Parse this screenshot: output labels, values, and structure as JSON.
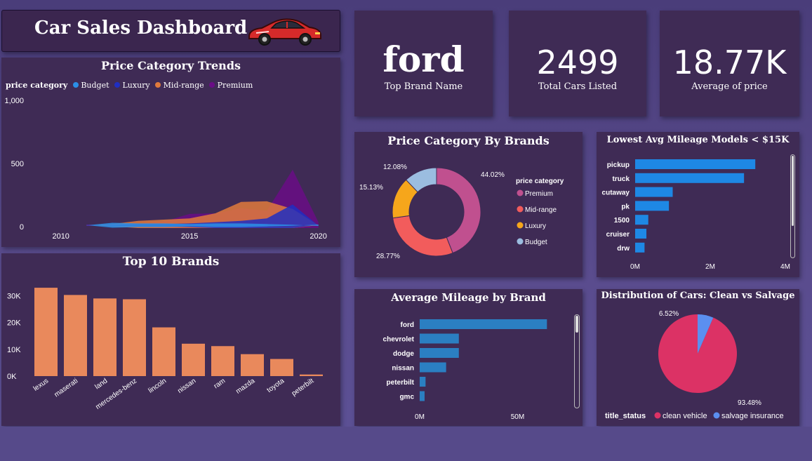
{
  "header": {
    "title": "Car Sales Dashboard",
    "car_icon": "red-sports-car"
  },
  "kpis": [
    {
      "value": "ford",
      "label": "Top Brand Name"
    },
    {
      "value": "2499",
      "label": "Total Cars Listed"
    },
    {
      "value": "18.77K",
      "label": "Average of price"
    }
  ],
  "colors": {
    "budget": "#2b8fe6",
    "luxury": "#1f2ec2",
    "midrange": "#e07a3c",
    "premium": "#6a0d86",
    "donut_premium": "#c0508f",
    "donut_midrange": "#f25c5c",
    "donut_luxury": "#f6a61b",
    "donut_budget": "#9bbde0",
    "hbar": "#1e88e5",
    "brand_bar": "#e9895c",
    "mileage_bar": "#2b7fc2",
    "pie_clean": "#dc3265",
    "pie_salvage": "#5b8ff0"
  },
  "chart_data": [
    {
      "id": "trends",
      "type": "area",
      "title": "Price Category Trends",
      "legend_title": "price category",
      "legend_position": "top-left",
      "y_ticks": [
        "1,000",
        "500",
        "0"
      ],
      "x_ticks": [
        "2010",
        "2015",
        "2020"
      ],
      "xlim": [
        2009,
        2020.5
      ],
      "ylim": [
        0,
        1000
      ],
      "x": [
        2011,
        2012,
        2013,
        2014,
        2015,
        2016,
        2017,
        2018,
        2019,
        2020
      ],
      "series": [
        {
          "name": "Budget",
          "values": [
            10,
            50,
            40,
            40,
            30,
            40,
            40,
            30,
            20,
            0
          ]
        },
        {
          "name": "Luxury",
          "values": [
            5,
            20,
            30,
            30,
            40,
            60,
            80,
            120,
            340,
            5
          ]
        },
        {
          "name": "Mid-range",
          "values": [
            5,
            30,
            80,
            100,
            120,
            200,
            380,
            390,
            270,
            10
          ]
        },
        {
          "name": "Premium",
          "values": [
            0,
            15,
            40,
            70,
            190,
            200,
            280,
            240,
            890,
            60
          ]
        }
      ]
    },
    {
      "id": "brands-donut",
      "type": "pie",
      "title": "Price Category By Brands",
      "legend_title": "price category",
      "legend_position": "right",
      "categories": [
        "Premium",
        "Mid-range",
        "Luxury",
        "Budget"
      ],
      "values": [
        44.02,
        28.77,
        15.13,
        12.08
      ],
      "labels": [
        "44.02%",
        "28.77%",
        "15.13%",
        "12.08%"
      ]
    },
    {
      "id": "low-mileage",
      "type": "bar",
      "orientation": "horizontal",
      "title": "Lowest Avg Mileage Models < $15K",
      "categories": [
        "pickup",
        "truck",
        "cutaway",
        "pk",
        "1500",
        "cruiser",
        "drw"
      ],
      "values": [
        3.2,
        2.9,
        1.0,
        0.9,
        0.35,
        0.3,
        0.25
      ],
      "x_ticks": [
        "0M",
        "2M",
        "4M"
      ],
      "xlim": [
        0,
        4
      ]
    },
    {
      "id": "top-brands",
      "type": "bar",
      "title": "Top 10 Brands",
      "categories": [
        "lexus",
        "maserati",
        "land",
        "mercedes-benz",
        "lincoln",
        "nissan",
        "ram",
        "mazda",
        "toyota",
        "peterbilt"
      ],
      "values": [
        33000,
        30300,
        29000,
        28700,
        18200,
        12100,
        11200,
        8200,
        6400,
        600
      ],
      "y_ticks": [
        "30K",
        "20K",
        "10K",
        "0K"
      ],
      "ylim": [
        0,
        38000
      ]
    },
    {
      "id": "avg-mileage",
      "type": "bar",
      "orientation": "horizontal",
      "title": "Average Mileage by Brand",
      "categories": [
        "ford",
        "chevrolet",
        "dodge",
        "nissan",
        "peterbilt",
        "gmc"
      ],
      "values": [
        65,
        20,
        20,
        13.5,
        3,
        2.5
      ],
      "x_ticks": [
        "0M",
        "50M"
      ],
      "xlim": [
        0,
        95
      ]
    },
    {
      "id": "clean-salvage",
      "type": "pie",
      "title": "Distribution of Cars: Clean vs Salvage",
      "legend_title": "title_status",
      "legend_position": "bottom",
      "categories": [
        "clean vehicle",
        "salvage insurance"
      ],
      "values": [
        93.48,
        6.52
      ],
      "labels": [
        "93.48%",
        "6.52%"
      ]
    }
  ]
}
